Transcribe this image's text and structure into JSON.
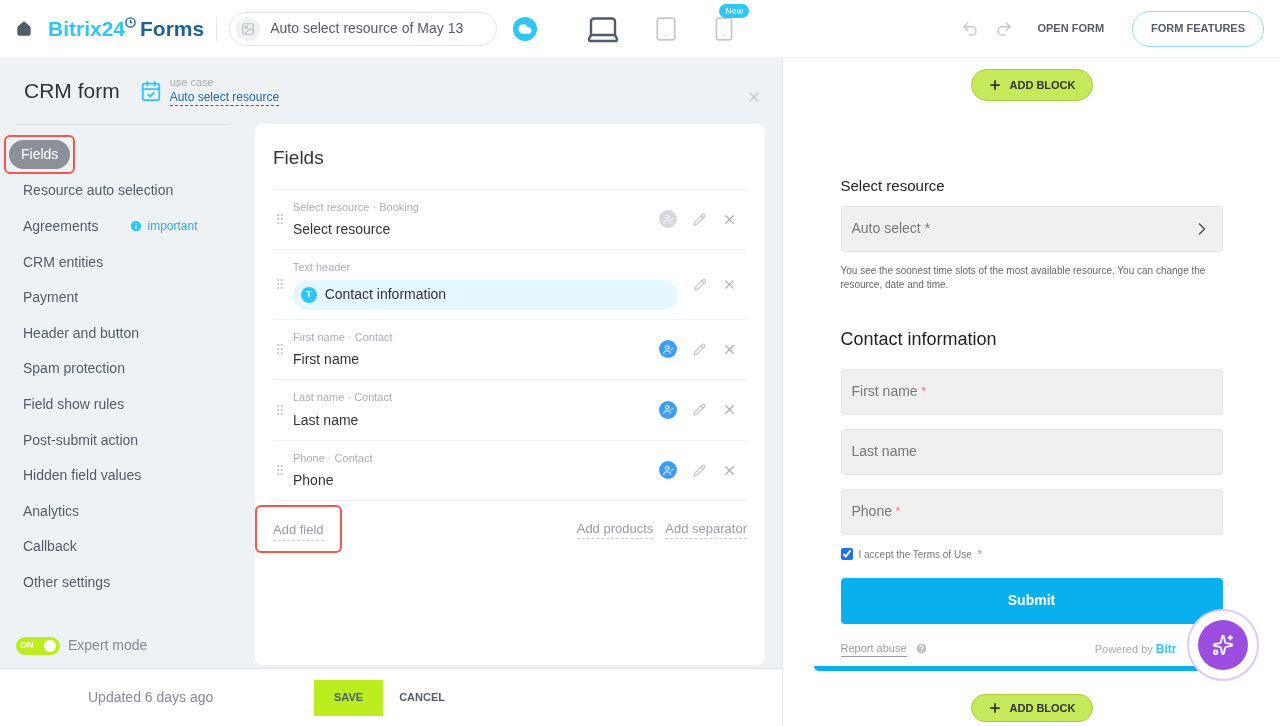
{
  "header": {
    "logo_brand": "Bitrix24",
    "logo_product": "Forms",
    "form_name": "Auto select resource of May 13",
    "devices": [
      {
        "kind": "desktop",
        "selected": true
      },
      {
        "kind": "tablet",
        "selected": false
      },
      {
        "kind": "phone",
        "selected": false,
        "badge": "New"
      }
    ],
    "open_form": "OPEN FORM",
    "features": "FORM FEATURES"
  },
  "panel": {
    "title": "CRM form",
    "use_case_label": "use case",
    "use_case": "Auto select resource"
  },
  "nav": [
    {
      "label": "Fields",
      "selected": true,
      "highlighted": true
    },
    {
      "label": "Resource auto selection",
      "selected": false,
      "highlighted": false
    },
    {
      "label": "Agreements",
      "selected": false,
      "highlighted": false,
      "note": "important"
    },
    {
      "label": "CRM entities",
      "selected": false,
      "highlighted": false
    },
    {
      "label": "Payment",
      "selected": false,
      "highlighted": false
    },
    {
      "label": "Header and button",
      "selected": false,
      "highlighted": false
    },
    {
      "label": "Spam protection",
      "selected": false,
      "highlighted": false
    },
    {
      "label": "Field show rules",
      "selected": false,
      "highlighted": false
    },
    {
      "label": "Post-submit action",
      "selected": false,
      "highlighted": false
    },
    {
      "label": "Hidden field values",
      "selected": false,
      "highlighted": false
    },
    {
      "label": "Analytics",
      "selected": false,
      "highlighted": false
    },
    {
      "label": "Callback",
      "selected": false,
      "highlighted": false
    },
    {
      "label": "Other settings",
      "selected": false,
      "highlighted": false
    }
  ],
  "expert_mode": {
    "label": "Expert mode",
    "toggle_text": "ON",
    "on": true
  },
  "fields_card": {
    "title": "Fields",
    "rows": [
      {
        "kind": "field",
        "meta": "Select resource · Booking",
        "name": "Select resource",
        "crm_linked": false
      },
      {
        "kind": "header",
        "meta": "Text header",
        "name": "Contact information",
        "badge": "T"
      },
      {
        "kind": "field",
        "meta": "First name · Contact",
        "name": "First name",
        "crm_linked": true
      },
      {
        "kind": "field",
        "meta": "Last name · Contact",
        "name": "Last name",
        "crm_linked": true
      },
      {
        "kind": "field",
        "meta": "Phone · Contact",
        "name": "Phone",
        "crm_linked": true
      }
    ],
    "add_field": {
      "label": "Add field",
      "highlighted": true
    },
    "links": [
      "Add products",
      "Add separator"
    ]
  },
  "footer": {
    "updated": "Updated 6 days ago",
    "save": "SAVE",
    "cancel": "CANCEL"
  },
  "preview": {
    "add_block": "ADD BLOCK",
    "resource_heading": "Select resource",
    "resource_select": "Auto select *",
    "hint": "You see the soonest time slots of the most available resource. You can change the resource, date and time.",
    "contact_heading": "Contact information",
    "inputs": [
      {
        "placeholder": "First name",
        "mark": "*"
      },
      {
        "placeholder": "Last name"
      },
      {
        "placeholder": "Phone",
        "mark": "*"
      }
    ],
    "terms": {
      "label": "I accept the Terms of Use",
      "checked": true,
      "mark": "*"
    },
    "submit": "Submit",
    "report": "Report abuse",
    "powered": "Powered by",
    "powered_brand": "Bitr",
    "add_block_bottom": "ADD BLOCK"
  }
}
